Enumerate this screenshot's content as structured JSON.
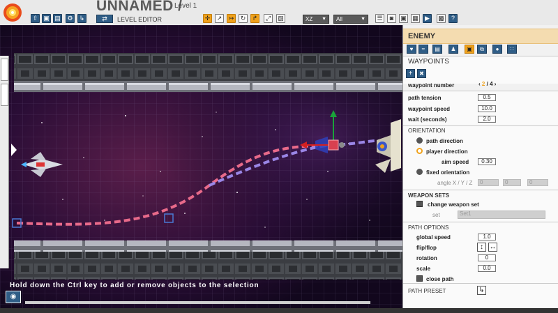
{
  "app": {
    "title": "UNNAMED /",
    "level": "Level 1",
    "editor_label": "LEVEL EDITOR",
    "swap_icon": "⇄"
  },
  "toolbar": {
    "file_buttons": [
      {
        "icon": "import-icon",
        "glyph": "⇧"
      },
      {
        "icon": "save-icon",
        "glyph": "▣"
      },
      {
        "icon": "save-as-icon",
        "glyph": "▤"
      },
      {
        "icon": "settings-icon",
        "glyph": "⚙"
      },
      {
        "icon": "export-icon",
        "glyph": "↳"
      }
    ],
    "tool_buttons": [
      {
        "icon": "move-icon",
        "glyph": "✛",
        "active": true
      },
      {
        "icon": "move-path-icon",
        "glyph": "↗",
        "active": false
      },
      {
        "icon": "path-tool-icon",
        "glyph": "↣",
        "active": true
      },
      {
        "icon": "rotate-icon",
        "glyph": "↻",
        "active": false
      },
      {
        "icon": "edit-path-icon",
        "glyph": "↱",
        "active": true
      },
      {
        "icon": "scale-icon",
        "glyph": "⤢",
        "active": false
      },
      {
        "icon": "snap-icon",
        "glyph": "▧",
        "active": false
      }
    ],
    "plane_select": "XZ",
    "filter_select": "All",
    "right_buttons": [
      {
        "icon": "layers-icon",
        "glyph": "☰"
      },
      {
        "icon": "camera-icon",
        "glyph": "◙"
      },
      {
        "icon": "screenshot-icon",
        "glyph": "▣"
      },
      {
        "icon": "grid-icon",
        "glyph": "▦"
      },
      {
        "icon": "play-icon",
        "glyph": "▶"
      },
      {
        "icon": "help-icon",
        "glyph": "?"
      }
    ]
  },
  "viewport": {
    "hint": "Hold down the Ctrl key to add or remove objects to the selection"
  },
  "panel": {
    "title": "ENEMY",
    "tabs": [
      {
        "icon": "health-icon",
        "glyph": "♥",
        "active": false
      },
      {
        "icon": "movement-icon",
        "glyph": "≈",
        "active": false
      },
      {
        "icon": "copy-icon",
        "glyph": "▤",
        "active": false
      },
      {
        "icon": "pilot-icon",
        "glyph": "♟",
        "active": false
      },
      {
        "icon": "waypoints-icon",
        "glyph": "▣",
        "active": true
      },
      {
        "icon": "duplicate-icon",
        "glyph": "⧉",
        "active": false
      },
      {
        "icon": "bomb-icon",
        "glyph": "●",
        "active": false
      },
      {
        "icon": "particles-icon",
        "glyph": "∷",
        "active": false
      }
    ],
    "waypoints": {
      "title": "WAYPOINTS",
      "add_glyph": "+",
      "delete_glyph": "✖",
      "number_label": "waypoint number",
      "prev": "‹",
      "current": "2",
      "sep": "/",
      "total": "4",
      "next": "›",
      "tension_label": "path tension",
      "tension": "0.5",
      "speed_label": "waypoint speed",
      "speed": "10.0",
      "wait_label": "wait (seconds)",
      "wait": "2.0"
    },
    "orientation": {
      "title": "ORIENTATION",
      "path_direction": "path direction",
      "player_direction": "player direction",
      "aim_speed_label": "aim speed",
      "aim_speed": "0.30",
      "fixed_orientation": "fixed orientation",
      "angle_label": "angle X / Y / Z",
      "angle_x": "0",
      "angle_y": "0",
      "angle_z": "0"
    },
    "weapon_sets": {
      "title": "WEAPON SETS",
      "change_label": "change weapon set",
      "set_label": "set",
      "set_value": "Set1"
    },
    "path_options": {
      "title": "PATH OPTIONS",
      "global_speed_label": "global speed",
      "global_speed": "1.0",
      "flip_flop_label": "flip/flop",
      "flip_v": "↕",
      "flip_h": "↔",
      "rotation_label": "rotation",
      "rotation": "0",
      "scale_label": "scale",
      "scale": "0.0",
      "close_path_label": "close path"
    },
    "path_preset": {
      "title": "PATH PRESET",
      "button_glyph": "↳"
    }
  }
}
